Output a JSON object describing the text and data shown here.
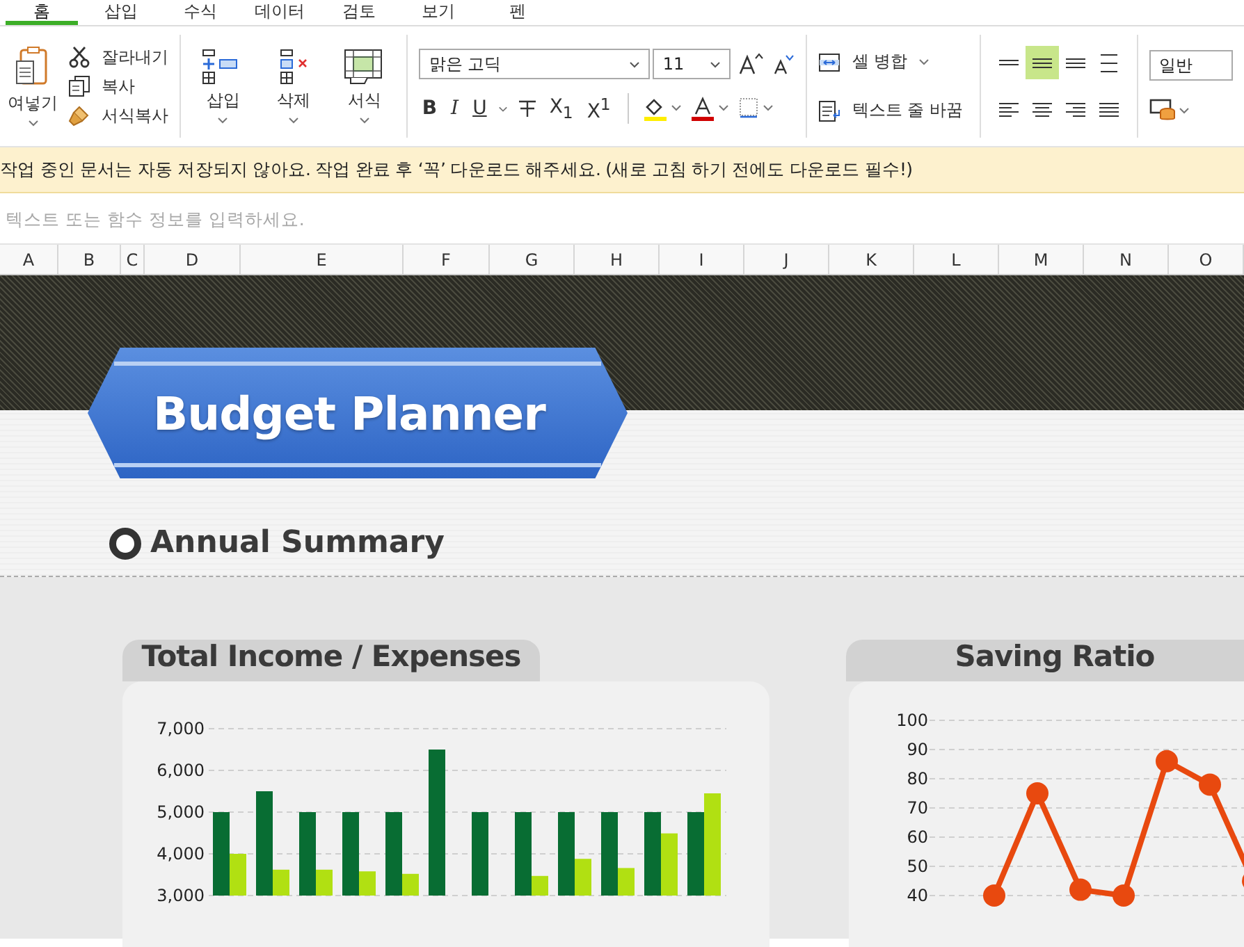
{
  "menu_tabs": [
    {
      "label": "홈",
      "selected": true
    },
    {
      "label": "삽입",
      "selected": false
    },
    {
      "label": "수식",
      "selected": false
    },
    {
      "label": "데이터",
      "selected": false
    },
    {
      "label": "검토",
      "selected": false
    },
    {
      "label": "보기",
      "selected": false
    },
    {
      "label": "펜",
      "selected": false
    }
  ],
  "ribbon": {
    "paste_label": "여넣기",
    "clipboard": [
      {
        "kind": "cut",
        "label": "잘라내기"
      },
      {
        "kind": "copy",
        "label": "복사"
      },
      {
        "kind": "format-painter",
        "label": "서식복사"
      }
    ],
    "cells": [
      {
        "kind": "insert",
        "label": "삽입"
      },
      {
        "kind": "delete",
        "label": "삭제"
      },
      {
        "kind": "format",
        "label": "서식"
      }
    ],
    "font_name": "맑은 고딕",
    "font_size": "11",
    "text_styles": [
      {
        "kind": "bold",
        "label": "B"
      },
      {
        "kind": "italic",
        "label": "I"
      },
      {
        "kind": "underline",
        "label": "U"
      },
      {
        "kind": "strike"
      },
      {
        "kind": "script",
        "label": "X$_{1}$"
      },
      {
        "kind": "script",
        "label": "X$^{1}$"
      }
    ],
    "merge_label": "셀 병합",
    "wrap_label": "텍스트 줄 바꿈",
    "alignments": [
      {
        "kind": "top",
        "selected": false
      },
      {
        "kind": "middle",
        "selected": true
      },
      {
        "kind": "bottom",
        "selected": false
      },
      {
        "kind": "spread",
        "selected": false
      },
      {
        "kind": "left",
        "selected": false
      },
      {
        "kind": "center",
        "selected": false
      },
      {
        "kind": "right",
        "selected": false
      },
      {
        "kind": "justify",
        "selected": false
      }
    ],
    "number_format": "일반"
  },
  "notice": "작업 중인 문서는 자동 저장되지 않아요. 작업 완료 후 ‘꼭’ 다운로드 해주세요. (새로 고침 하기 전에도 다운로드 필수!)",
  "formula_bar": {
    "placeholder": "텍스트 또는 함수 정보를 입력하세요."
  },
  "columns": [
    "A",
    "B",
    "C",
    "D",
    "E",
    "F",
    "G",
    "H",
    "I",
    "J",
    "K",
    "L",
    "M",
    "N",
    "O"
  ],
  "sheet": {
    "title": "Budget Planner",
    "section": "Annual Summary",
    "cards": [
      {
        "title": "Total Income / Expenses",
        "chart_data": {
          "type": "bar",
          "grid": true,
          "ylim": [
            3000,
            7000
          ],
          "yticks": [
            {
              "value": 3000,
              "label": "3,000"
            },
            {
              "value": 4000,
              "label": "4,000"
            },
            {
              "value": 5000,
              "label": "5,000"
            },
            {
              "value": 6000,
              "label": "6,000"
            },
            {
              "value": 7000,
              "label": "7,000"
            }
          ],
          "series": [
            {
              "color": "#086d33",
              "values": [
                5000,
                5500,
                5000,
                5000,
                5000,
                6500,
                5000,
                5000,
                5000,
                5000,
                5000,
                5000
              ]
            },
            {
              "color": "#b1e012",
              "values": [
                4000,
                3620,
                3620,
                3580,
                3520,
                null,
                null,
                3470,
                3880,
                3660,
                4490,
                5450
              ]
            }
          ]
        }
      },
      {
        "title": "Saving Ratio",
        "chart_data": {
          "type": "line",
          "grid": true,
          "ylim": [
            40,
            100
          ],
          "yticks": [
            40,
            50,
            60,
            70,
            80,
            90,
            100
          ],
          "series": [
            {
              "color": "#e8490f",
              "marker": true,
              "values": [
                null,
                40,
                75,
                42,
                40,
                86,
                78,
                45
              ]
            }
          ]
        }
      }
    ]
  }
}
